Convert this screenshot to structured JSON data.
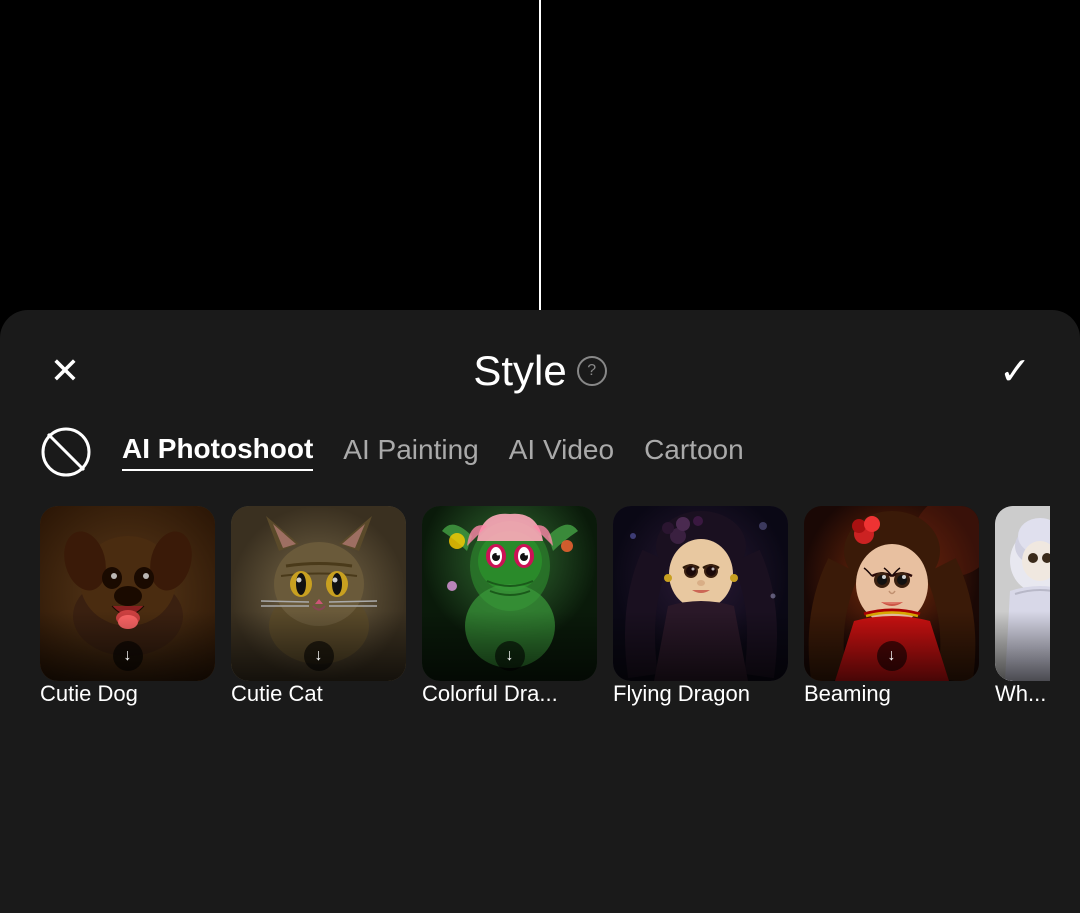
{
  "topArea": {
    "verticalLine": true
  },
  "panel": {
    "title": "Style",
    "helpTooltip": "?",
    "closeLabel": "✕",
    "confirmLabel": "✓"
  },
  "categories": [
    {
      "id": "no-style",
      "label": "",
      "icon": "no-style",
      "active": false
    },
    {
      "id": "ai-photoshoot",
      "label": "AI Photoshoot",
      "active": true
    },
    {
      "id": "ai-painting",
      "label": "AI Painting",
      "active": false
    },
    {
      "id": "ai-video",
      "label": "AI Video",
      "active": false
    },
    {
      "id": "cartoon",
      "label": "Cartoon",
      "active": false
    }
  ],
  "styleItems": [
    {
      "id": "cutie-dog",
      "label": "Cutie Dog",
      "hasDownload": true,
      "colorClass": "img-cutie-dog",
      "emoji": "🐕"
    },
    {
      "id": "cutie-cat",
      "label": "Cutie Cat",
      "hasDownload": true,
      "colorClass": "img-cutie-cat",
      "emoji": "🐱"
    },
    {
      "id": "colorful-dragon",
      "label": "Colorful Dra...",
      "hasDownload": true,
      "colorClass": "img-colorful-dragon",
      "emoji": "🐲"
    },
    {
      "id": "flying-dragon",
      "label": "Flying Dragon",
      "hasDownload": false,
      "colorClass": "img-flying-dragon",
      "emoji": "👸"
    },
    {
      "id": "beaming",
      "label": "Beaming",
      "hasDownload": true,
      "colorClass": "img-beaming",
      "emoji": "💃"
    },
    {
      "id": "white",
      "label": "Wh...",
      "hasDownload": false,
      "colorClass": "img-white",
      "emoji": "🤺"
    }
  ],
  "colors": {
    "background": "#000000",
    "panelBg": "#1a1a1a",
    "text": "#ffffff",
    "inactive": "#aaaaaa",
    "accent": "#ffffff"
  }
}
